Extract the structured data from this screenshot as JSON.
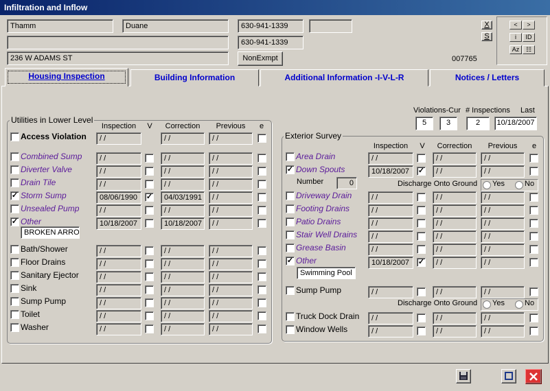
{
  "window_title": "Infiltration and Inflow",
  "header": {
    "last_name": "Thamm",
    "first_name": "Duane",
    "phone1": "630-941-1339",
    "phone2": "630-941-1339",
    "extra1": "",
    "extra2": "",
    "address": "236 W ADAMS ST",
    "exempt_btn": "NonExmpt",
    "x_btn": "X",
    "s_btn": "S",
    "record_id": "007765"
  },
  "nav": {
    "prev": "<",
    "next": ">",
    "info": "i",
    "id": "ID",
    "az": "Az",
    "grid": "☷"
  },
  "tabs": [
    "Housing Inspection",
    "Building Information",
    "Additional Information -I-V-L-R",
    "Notices / Letters"
  ],
  "counts": {
    "violations_label": "Violations-Cur",
    "violations1": "5",
    "violations2": "3",
    "inspections_label": "# Inspections",
    "inspections": "2",
    "last_label": "Last",
    "last": "10/18/2007"
  },
  "utilities": {
    "title": "Utilities in Lower Level",
    "headers": [
      "Inspection",
      "V",
      "Correction",
      "Previous",
      "e"
    ],
    "access_violation": {
      "label": "Access Violation",
      "insp": " / /",
      "corr": " / /",
      "prev": " / /"
    },
    "rows": [
      {
        "label": "Combined Sump",
        "checked": false,
        "insp": " / /",
        "v": false,
        "corr": " / /",
        "prev": " / /"
      },
      {
        "label": "Diverter Valve",
        "checked": false,
        "insp": " / /",
        "v": false,
        "corr": " / /",
        "prev": " / /"
      },
      {
        "label": "Drain Tile",
        "checked": false,
        "insp": " / /",
        "v": false,
        "corr": " / /",
        "prev": " / /"
      },
      {
        "label": "Storm Sump",
        "checked": true,
        "insp": "08/06/1990",
        "v": true,
        "corr": "04/03/1991",
        "prev": " / /"
      },
      {
        "label": "Unsealed Pump",
        "checked": false,
        "insp": " / /",
        "v": false,
        "corr": " / /",
        "prev": " / /"
      },
      {
        "label": "Other",
        "checked": true,
        "insp": "10/18/2007",
        "v": false,
        "corr": "10/18/2007",
        "prev": " / /"
      }
    ],
    "other_text": "BROKEN ARROW",
    "rows2": [
      {
        "label": "Bath/Shower",
        "insp": " / /",
        "corr": " / /",
        "prev": " / /"
      },
      {
        "label": "Floor Drains",
        "insp": " / /",
        "corr": " / /",
        "prev": " / /"
      },
      {
        "label": "Sanitary Ejector",
        "insp": " / /",
        "corr": " / /",
        "prev": " / /"
      },
      {
        "label": "Sink",
        "insp": " / /",
        "corr": " / /",
        "prev": " / /"
      },
      {
        "label": "Sump Pump",
        "insp": " / /",
        "corr": " / /",
        "prev": " / /"
      },
      {
        "label": "Toilet",
        "insp": " / /",
        "corr": " / /",
        "prev": " / /"
      },
      {
        "label": "Washer",
        "insp": " / /",
        "corr": " / /",
        "prev": " / /"
      }
    ]
  },
  "exterior": {
    "title": "Exterior Survey",
    "headers": [
      "Inspection",
      "V",
      "Correction",
      "Previous",
      "e"
    ],
    "rows": [
      {
        "label": "Area Drain",
        "checked": false,
        "insp": " / /",
        "v": false,
        "corr": " / /",
        "prev": " / /"
      },
      {
        "label": "Down Spouts",
        "checked": true,
        "insp": "10/18/2007",
        "v": true,
        "corr": " / /",
        "prev": " / /"
      }
    ],
    "number_label": "Number",
    "number": "0",
    "discharge_label": "Discharge Onto Ground",
    "yes": "Yes",
    "no": "No",
    "rows2": [
      {
        "label": "Driveway Drain",
        "checked": false,
        "insp": " / /",
        "v": false,
        "corr": " / /",
        "prev": " / /"
      },
      {
        "label": "Footing Drains",
        "checked": false,
        "insp": " / /",
        "v": false,
        "corr": " / /",
        "prev": " / /"
      },
      {
        "label": "Patio Drains",
        "checked": false,
        "insp": " / /",
        "v": false,
        "corr": " / /",
        "prev": " / /"
      },
      {
        "label": "Stair Well Drains",
        "checked": false,
        "insp": " / /",
        "v": false,
        "corr": " / /",
        "prev": " / /"
      },
      {
        "label": "Grease Basin",
        "checked": false,
        "insp": " / /",
        "v": false,
        "corr": " / /",
        "prev": " / /"
      },
      {
        "label": "Other",
        "checked": true,
        "insp": "10/18/2007",
        "v": true,
        "corr": " / /",
        "prev": " / /"
      }
    ],
    "other_text": "Swimming Pool",
    "sump": {
      "label": "Sump Pump",
      "insp": " / /",
      "corr": " / /",
      "prev": " / /"
    },
    "rows3": [
      {
        "label": "Truck Dock Drain",
        "insp": " / /",
        "corr": " / /",
        "prev": " / /"
      },
      {
        "label": "Window Wells",
        "insp": " / /",
        "corr": " / /",
        "prev": " / /"
      }
    ]
  }
}
